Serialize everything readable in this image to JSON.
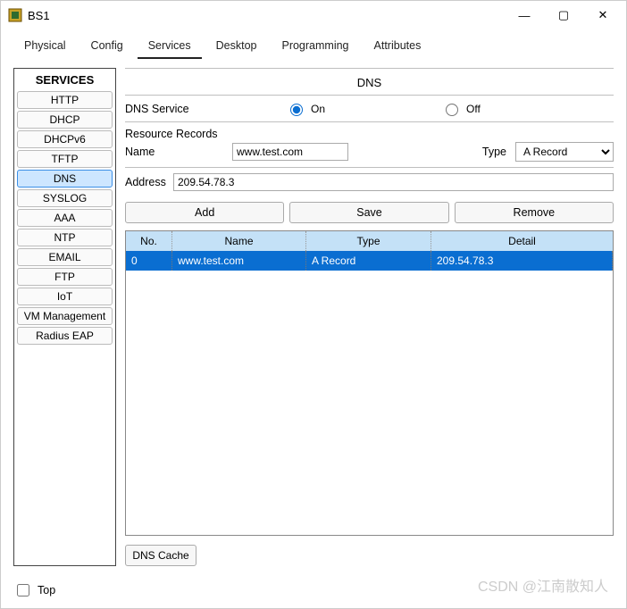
{
  "window": {
    "title": "BS1",
    "controls": {
      "min": "—",
      "max": "▢",
      "close": "✕"
    }
  },
  "tabs": {
    "items": [
      {
        "label": "Physical"
      },
      {
        "label": "Config"
      },
      {
        "label": "Services"
      },
      {
        "label": "Desktop"
      },
      {
        "label": "Programming"
      },
      {
        "label": "Attributes"
      }
    ],
    "activeIndex": 2
  },
  "sidebar": {
    "header": "SERVICES",
    "items": [
      {
        "label": "HTTP"
      },
      {
        "label": "DHCP"
      },
      {
        "label": "DHCPv6"
      },
      {
        "label": "TFTP"
      },
      {
        "label": "DNS"
      },
      {
        "label": "SYSLOG"
      },
      {
        "label": "AAA"
      },
      {
        "label": "NTP"
      },
      {
        "label": "EMAIL"
      },
      {
        "label": "FTP"
      },
      {
        "label": "IoT"
      },
      {
        "label": "VM Management"
      },
      {
        "label": "Radius EAP"
      }
    ],
    "selectedIndex": 4
  },
  "pane": {
    "title": "DNS",
    "serviceLabel": "DNS Service",
    "onLabel": "On",
    "offLabel": "Off",
    "serviceOn": true,
    "resourceRecordsLabel": "Resource Records",
    "nameLabel": "Name",
    "nameValue": "www.test.com",
    "typeLabel": "Type",
    "typeValue": "A Record",
    "addressLabel": "Address",
    "addressValue": "209.54.78.3",
    "buttons": {
      "add": "Add",
      "save": "Save",
      "remove": "Remove"
    },
    "table": {
      "headers": {
        "no": "No.",
        "name": "Name",
        "type": "Type",
        "detail": "Detail"
      },
      "rows": [
        {
          "no": "0",
          "name": "www.test.com",
          "type": "A Record",
          "detail": "209.54.78.3"
        }
      ]
    },
    "cacheButton": "DNS Cache"
  },
  "bottom": {
    "topLabel": "Top",
    "topChecked": false
  },
  "watermark": "CSDN @江南散知人"
}
